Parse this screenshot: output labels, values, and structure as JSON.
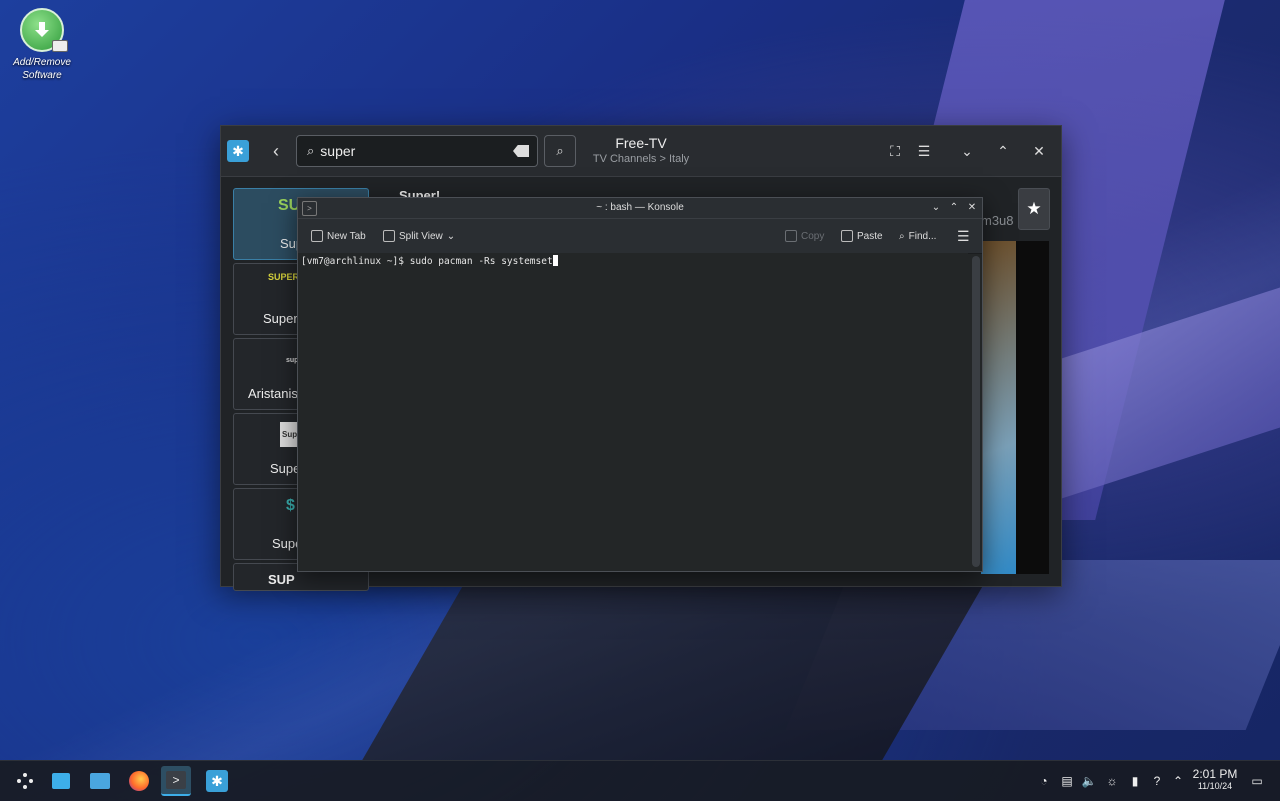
{
  "desktop": {
    "icon_label": "Add/Remove Software"
  },
  "store": {
    "search_value": "super",
    "title": "Free-TV",
    "subtitle": "TV Channels > Italy",
    "detail_title": "Super!",
    "detail_id_fragment": "m3u8",
    "cards": [
      {
        "logo": "SUP",
        "name": "Sup"
      },
      {
        "logo": "SUPER",
        "name": "Super"
      },
      {
        "logo": "super",
        "name": "Aristanis"
      },
      {
        "logo": "Sup",
        "name": "Super"
      },
      {
        "logo": "$",
        "name": "Supe"
      },
      {
        "logo": "SUP",
        "name": ""
      }
    ]
  },
  "konsole": {
    "title": "~ : bash — Konsole",
    "new_tab_label": "New Tab",
    "split_view_label": "Split View",
    "copy_label": "Copy",
    "paste_label": "Paste",
    "find_label": "Find...",
    "prompt": "[vm7@archlinux ~]$",
    "command": "sudo pacman -Rs systemset"
  },
  "taskbar": {
    "time": "2:01 PM",
    "date": "11/10/24",
    "apps": [
      "app-launcher",
      "discover",
      "file-manager",
      "firefox",
      "konsole",
      "discover-store"
    ],
    "accent": "#3daee9"
  }
}
